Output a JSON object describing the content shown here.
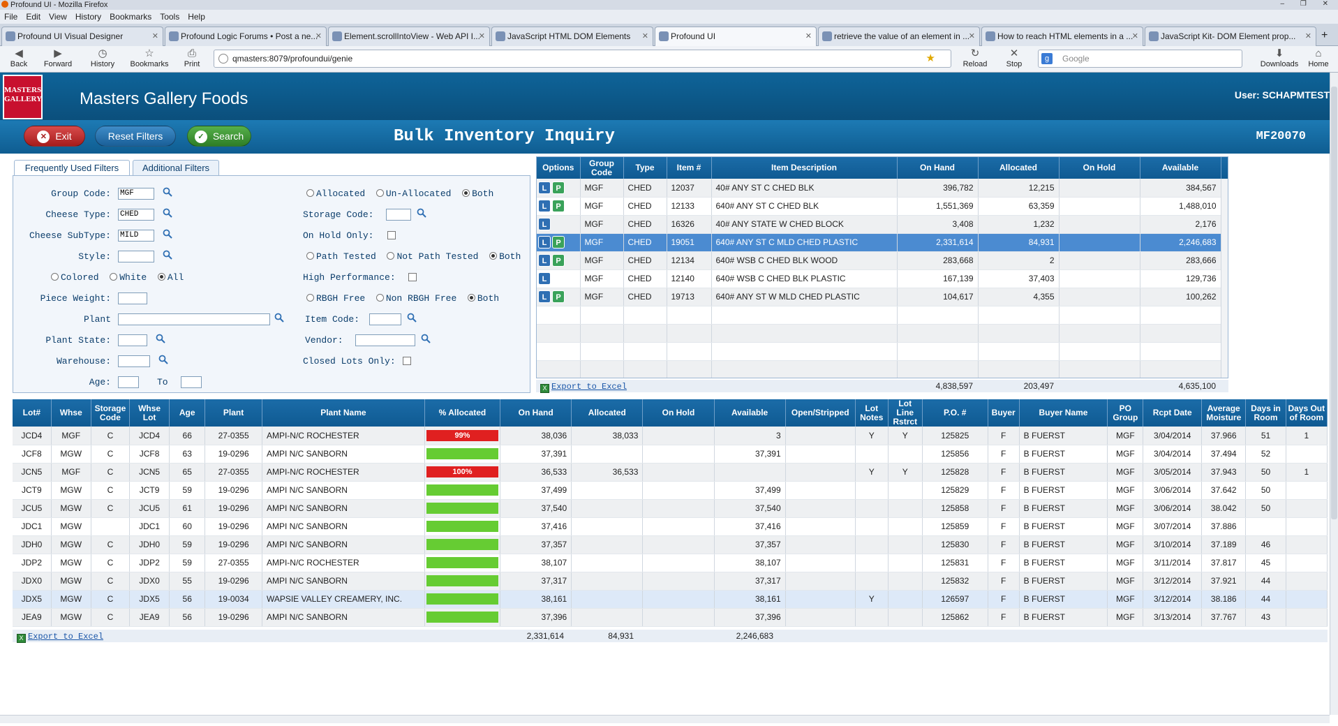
{
  "window": {
    "title": "Profound UI - Mozilla Firefox"
  },
  "menubar": [
    "File",
    "Edit",
    "View",
    "History",
    "Bookmarks",
    "Tools",
    "Help"
  ],
  "tabs": [
    {
      "label": "Profound UI Visual Designer"
    },
    {
      "label": "Profound Logic Forums • Post a ne..."
    },
    {
      "label": "Element.scrollIntoView - Web API I..."
    },
    {
      "label": "JavaScript HTML DOM Elements"
    },
    {
      "label": "Profound UI",
      "active": true
    },
    {
      "label": "retrieve the value of an element in ..."
    },
    {
      "label": "How to reach HTML elements in a ..."
    },
    {
      "label": "JavaScript Kit- DOM Element prop..."
    }
  ],
  "nav": {
    "back": "Back",
    "forward": "Forward",
    "history": "History",
    "bookmarks": "Bookmarks",
    "print": "Print",
    "url": "qmasters:8079/profoundui/genie",
    "reload": "Reload",
    "stop": "Stop",
    "search_placeholder": "Google",
    "downloads": "Downloads",
    "home": "Home"
  },
  "app": {
    "company": "Masters Gallery Foods",
    "user": "User: SCHAPMTEST",
    "logo": "MASTERS GALLERY",
    "title": "Bulk Inventory Inquiry",
    "program": "MF20070"
  },
  "toolbar": {
    "exit": "Exit",
    "reset": "Reset Filters",
    "search": "Search"
  },
  "filters": {
    "tab_frequent": "Frequently Used Filters",
    "tab_additional": "Additional Filters",
    "group_code_label": "Group Code:",
    "group_code": "MGF",
    "cheese_type_label": "Cheese Type:",
    "cheese_type": "CHED",
    "cheese_subtype_label": "Cheese SubType:",
    "cheese_subtype": "MILD",
    "style_label": "Style:",
    "style": "",
    "color_colored": "Colored",
    "color_white": "White",
    "color_all": "All",
    "piece_weight_label": "Piece Weight:",
    "plant_label": "Plant",
    "plant_state_label": "Plant State:",
    "warehouse_label": "Warehouse:",
    "age_label": "Age:",
    "to_label": "To",
    "alloc_allocated": "Allocated",
    "alloc_unallocated": "Un-Allocated",
    "alloc_both": "Both",
    "storage_code_label": "Storage Code:",
    "on_hold_only_label": "On Hold Only:",
    "path_tested": "Path Tested",
    "not_path_tested": "Not Path Tested",
    "path_both": "Both",
    "high_perf_label": "High Performance:",
    "rbgh_free": "RBGH Free",
    "non_rbgh_free": "Non RBGH Free",
    "rbgh_both": "Both",
    "item_code_label": "Item Code:",
    "vendor_label": "Vendor:",
    "closed_lots_label": "Closed Lots Only:"
  },
  "items_grid": {
    "headers": [
      "Options",
      "Group Code",
      "Type",
      "Item #",
      "Item Description",
      "On Hand",
      "Allocated",
      "On Hold",
      "Available"
    ],
    "rows": [
      {
        "p": true,
        "group": "MGF",
        "type": "CHED",
        "item": "12037",
        "desc": "40# ANY ST C CHED BLK",
        "onhand": "396,782",
        "alloc": "12,215",
        "hold": "",
        "avail": "384,567"
      },
      {
        "p": true,
        "group": "MGF",
        "type": "CHED",
        "item": "12133",
        "desc": "640# ANY ST C CHED BLK",
        "onhand": "1,551,369",
        "alloc": "63,359",
        "hold": "",
        "avail": "1,488,010"
      },
      {
        "p": false,
        "group": "MGF",
        "type": "CHED",
        "item": "16326",
        "desc": "40# ANY STATE W CHED BLOCK",
        "onhand": "3,408",
        "alloc": "1,232",
        "hold": "",
        "avail": "2,176"
      },
      {
        "p": true,
        "group": "MGF",
        "type": "CHED",
        "item": "19051",
        "desc": "640# ANY ST C MLD CHED PLASTIC",
        "onhand": "2,331,614",
        "alloc": "84,931",
        "hold": "",
        "avail": "2,246,683",
        "selected": true
      },
      {
        "p": true,
        "group": "MGF",
        "type": "CHED",
        "item": "12134",
        "desc": "640# WSB C CHED BLK WOOD",
        "onhand": "283,668",
        "alloc": "2",
        "hold": "",
        "avail": "283,666"
      },
      {
        "p": false,
        "group": "MGF",
        "type": "CHED",
        "item": "12140",
        "desc": "640# WSB C CHED BLK PLASTIC",
        "onhand": "167,139",
        "alloc": "37,403",
        "hold": "",
        "avail": "129,736"
      },
      {
        "p": true,
        "group": "MGF",
        "type": "CHED",
        "item": "19713",
        "desc": "640# ANY ST W MLD CHED PLASTIC",
        "onhand": "104,617",
        "alloc": "4,355",
        "hold": "",
        "avail": "100,262"
      }
    ],
    "export": "Export to Excel",
    "totals": {
      "onhand": "4,838,597",
      "alloc": "203,497",
      "avail": "4,635,100"
    }
  },
  "lots_grid": {
    "headers": [
      "Lot#",
      "Whse",
      "Storage Code",
      "Whse Lot",
      "Age",
      "Plant",
      "Plant Name",
      "% Allocated",
      "On Hand",
      "Allocated",
      "On Hold",
      "Available",
      "Open/Stripped",
      "Lot Notes",
      "Lot Line Rstrct",
      "P.O. #",
      "Buyer",
      "Buyer Name",
      "PO Group",
      "Rcpt Date",
      "Average Moisture",
      "Days in Room",
      "Days Out of Room"
    ],
    "rows": [
      {
        "lot": "JCD4",
        "whse": "MGF",
        "sc": "C",
        "wl": "JCD4",
        "age": "66",
        "plant": "27-0355",
        "pname": "AMPI-N/C ROCHESTER",
        "pct": 0.99,
        "pctlabel": "99%",
        "onhand": "38,036",
        "alloc": "38,033",
        "hold": "",
        "avail": "3",
        "os": "",
        "notes": "Y",
        "rstrct": "Y",
        "po": "125825",
        "buyer": "F",
        "bname": "B FUERST",
        "pog": "MGF",
        "rcpt": "3/04/2014",
        "moist": "37.966",
        "din": "51",
        "dout": "1"
      },
      {
        "lot": "JCF8",
        "whse": "MGW",
        "sc": "C",
        "wl": "JCF8",
        "age": "63",
        "plant": "19-0296",
        "pname": "AMPI N/C SANBORN",
        "pct": 0,
        "pctlabel": "",
        "onhand": "37,391",
        "alloc": "",
        "hold": "",
        "avail": "37,391",
        "os": "",
        "notes": "",
        "rstrct": "",
        "po": "125856",
        "buyer": "F",
        "bname": "B FUERST",
        "pog": "MGF",
        "rcpt": "3/04/2014",
        "moist": "37.494",
        "din": "52",
        "dout": ""
      },
      {
        "lot": "JCN5",
        "whse": "MGF",
        "sc": "C",
        "wl": "JCN5",
        "age": "65",
        "plant": "27-0355",
        "pname": "AMPI-N/C ROCHESTER",
        "pct": 1,
        "pctlabel": "100%",
        "onhand": "36,533",
        "alloc": "36,533",
        "hold": "",
        "avail": "",
        "os": "",
        "notes": "Y",
        "rstrct": "Y",
        "po": "125828",
        "buyer": "F",
        "bname": "B FUERST",
        "pog": "MGF",
        "rcpt": "3/05/2014",
        "moist": "37.943",
        "din": "50",
        "dout": "1"
      },
      {
        "lot": "JCT9",
        "whse": "MGW",
        "sc": "C",
        "wl": "JCT9",
        "age": "59",
        "plant": "19-0296",
        "pname": "AMPI N/C SANBORN",
        "pct": 0,
        "pctlabel": "",
        "onhand": "37,499",
        "alloc": "",
        "hold": "",
        "avail": "37,499",
        "os": "",
        "notes": "",
        "rstrct": "",
        "po": "125829",
        "buyer": "F",
        "bname": "B FUERST",
        "pog": "MGF",
        "rcpt": "3/06/2014",
        "moist": "37.642",
        "din": "50",
        "dout": ""
      },
      {
        "lot": "JCU5",
        "whse": "MGW",
        "sc": "C",
        "wl": "JCU5",
        "age": "61",
        "plant": "19-0296",
        "pname": "AMPI N/C SANBORN",
        "pct": 0,
        "pctlabel": "",
        "onhand": "37,540",
        "alloc": "",
        "hold": "",
        "avail": "37,540",
        "os": "",
        "notes": "",
        "rstrct": "",
        "po": "125858",
        "buyer": "F",
        "bname": "B FUERST",
        "pog": "MGF",
        "rcpt": "3/06/2014",
        "moist": "38.042",
        "din": "50",
        "dout": ""
      },
      {
        "lot": "JDC1",
        "whse": "MGW",
        "sc": "",
        "wl": "JDC1",
        "age": "60",
        "plant": "19-0296",
        "pname": "AMPI N/C SANBORN",
        "pct": 0,
        "pctlabel": "",
        "onhand": "37,416",
        "alloc": "",
        "hold": "",
        "avail": "37,416",
        "os": "",
        "notes": "",
        "rstrct": "",
        "po": "125859",
        "buyer": "F",
        "bname": "B FUERST",
        "pog": "MGF",
        "rcpt": "3/07/2014",
        "moist": "37.886",
        "din": "",
        "dout": ""
      },
      {
        "lot": "JDH0",
        "whse": "MGW",
        "sc": "C",
        "wl": "JDH0",
        "age": "59",
        "plant": "19-0296",
        "pname": "AMPI N/C SANBORN",
        "pct": 0,
        "pctlabel": "",
        "onhand": "37,357",
        "alloc": "",
        "hold": "",
        "avail": "37,357",
        "os": "",
        "notes": "",
        "rstrct": "",
        "po": "125830",
        "buyer": "F",
        "bname": "B FUERST",
        "pog": "MGF",
        "rcpt": "3/10/2014",
        "moist": "37.189",
        "din": "46",
        "dout": ""
      },
      {
        "lot": "JDP2",
        "whse": "MGW",
        "sc": "C",
        "wl": "JDP2",
        "age": "59",
        "plant": "27-0355",
        "pname": "AMPI-N/C ROCHESTER",
        "pct": 0,
        "pctlabel": "",
        "onhand": "38,107",
        "alloc": "",
        "hold": "",
        "avail": "38,107",
        "os": "",
        "notes": "",
        "rstrct": "",
        "po": "125831",
        "buyer": "F",
        "bname": "B FUERST",
        "pog": "MGF",
        "rcpt": "3/11/2014",
        "moist": "37.817",
        "din": "45",
        "dout": ""
      },
      {
        "lot": "JDX0",
        "whse": "MGW",
        "sc": "C",
        "wl": "JDX0",
        "age": "55",
        "plant": "19-0296",
        "pname": "AMPI N/C SANBORN",
        "pct": 0,
        "pctlabel": "",
        "onhand": "37,317",
        "alloc": "",
        "hold": "",
        "avail": "37,317",
        "os": "",
        "notes": "",
        "rstrct": "",
        "po": "125832",
        "buyer": "F",
        "bname": "B FUERST",
        "pog": "MGF",
        "rcpt": "3/12/2014",
        "moist": "37.921",
        "din": "44",
        "dout": ""
      },
      {
        "lot": "JDX5",
        "whse": "MGW",
        "sc": "C",
        "wl": "JDX5",
        "age": "56",
        "plant": "19-0034",
        "pname": "WAPSIE VALLEY CREAMERY, INC.",
        "pct": 0,
        "pctlabel": "",
        "onhand": "38,161",
        "alloc": "",
        "hold": "",
        "avail": "38,161",
        "os": "",
        "notes": "Y",
        "rstrct": "",
        "po": "126597",
        "buyer": "F",
        "bname": "B FUERST",
        "pog": "MGF",
        "rcpt": "3/12/2014",
        "moist": "38.186",
        "din": "44",
        "dout": "",
        "highlight": true
      },
      {
        "lot": "JEA9",
        "whse": "MGW",
        "sc": "C",
        "wl": "JEA9",
        "age": "56",
        "plant": "19-0296",
        "pname": "AMPI N/C SANBORN",
        "pct": 0,
        "pctlabel": "",
        "onhand": "37,396",
        "alloc": "",
        "hold": "",
        "avail": "37,396",
        "os": "",
        "notes": "",
        "rstrct": "",
        "po": "125862",
        "buyer": "F",
        "bname": "B FUERST",
        "pog": "MGF",
        "rcpt": "3/13/2014",
        "moist": "37.767",
        "din": "43",
        "dout": ""
      }
    ],
    "export": "Export to Excel",
    "totals": {
      "onhand": "2,331,614",
      "alloc": "84,931",
      "avail": "2,246,683"
    }
  },
  "colors": {
    "header_blue": "#0e6499",
    "alloc_red": "#e02020",
    "alloc_green": "#66cc33",
    "selected_row": "#4b8bd1"
  }
}
